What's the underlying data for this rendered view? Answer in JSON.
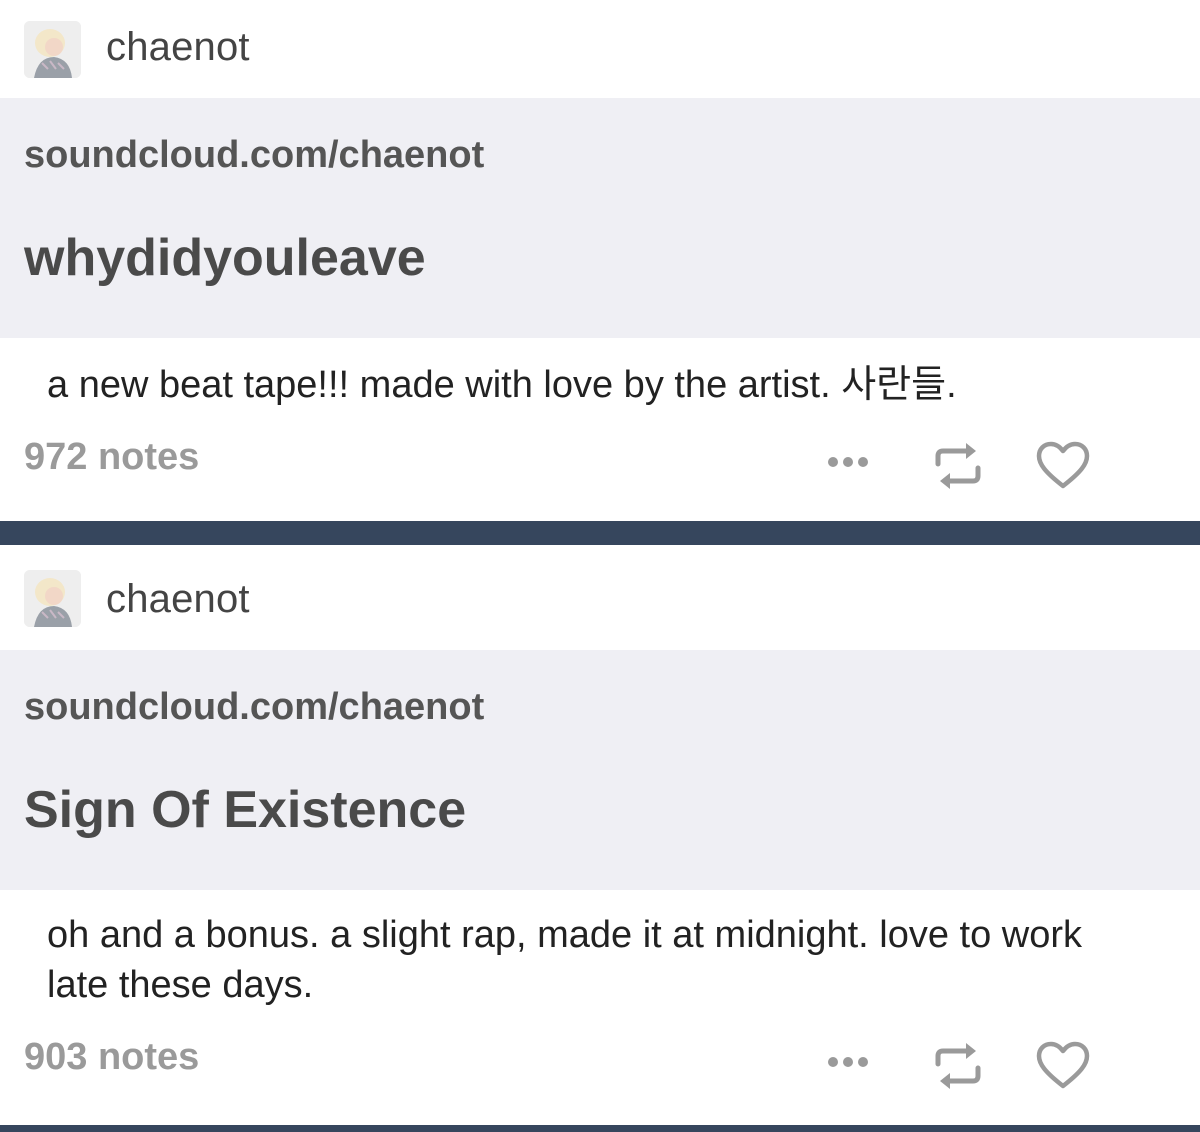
{
  "posts": [
    {
      "username": "chaenot",
      "link": {
        "url": "soundcloud.com/chaenot",
        "title": "whydidyouleave"
      },
      "caption": "a new beat tape!!! made with love by the artist. 사란들.",
      "notes": "972 notes"
    },
    {
      "username": "chaenot",
      "link": {
        "url": "soundcloud.com/chaenot",
        "title": "Sign Of Existence"
      },
      "caption": "oh and a bonus. a slight rap, made it at midnight. love to work late these days.",
      "notes": "903 notes"
    }
  ],
  "icons": {
    "more": "more-dots-icon",
    "reblog": "reblog-icon",
    "like": "heart-icon"
  },
  "colors": {
    "divider": "#36465d",
    "card_bg": "#efeff4",
    "icon": "#9a9a9a"
  }
}
